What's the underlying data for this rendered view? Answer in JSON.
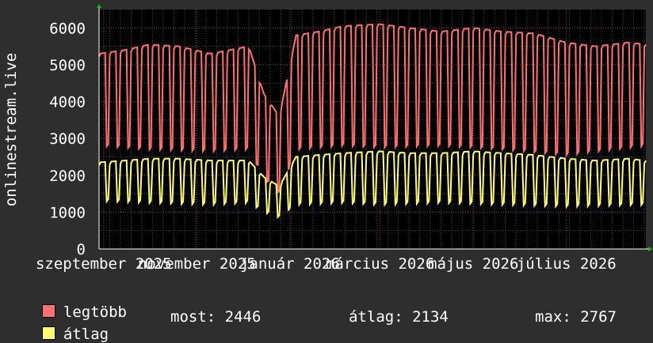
{
  "chart_data": {
    "type": "line",
    "ylabel": "onlinestream.live",
    "ylim": [
      0,
      6500
    ],
    "yticks": [
      0,
      1000,
      2000,
      3000,
      4000,
      5000,
      6000
    ],
    "grid": true,
    "xlim": [
      "2025-08-29",
      "2026-08-22"
    ],
    "xticks": [
      {
        "date": "2025-09-01",
        "label": "szeptember 2025"
      },
      {
        "date": "2025-11-01",
        "label": "november 2025"
      },
      {
        "date": "2026-01-01",
        "label": "január 2026"
      },
      {
        "date": "2026-03-01",
        "label": "március 2026"
      },
      {
        "date": "2026-05-01",
        "label": "május 2026"
      },
      {
        "date": "2026-07-01",
        "label": "július 2026"
      }
    ],
    "series": [
      {
        "name": "legtöbb",
        "color": "#ff7070",
        "values": [
          {
            "x": "2025-08-29",
            "y": 5300
          },
          {
            "x": "2025-09-15",
            "y": 5400
          },
          {
            "x": "2025-10-01",
            "y": 5550
          },
          {
            "x": "2025-10-20",
            "y": 5500
          },
          {
            "x": "2025-11-10",
            "y": 5300
          },
          {
            "x": "2025-12-05",
            "y": 5500
          },
          {
            "x": "2025-12-15",
            "y": 4200
          },
          {
            "x": "2025-12-25",
            "y": 3600
          },
          {
            "x": "2026-01-05",
            "y": 5800
          },
          {
            "x": "2026-01-20",
            "y": 5900
          },
          {
            "x": "2026-02-05",
            "y": 6050
          },
          {
            "x": "2026-03-01",
            "y": 6100
          },
          {
            "x": "2026-03-20",
            "y": 6000
          },
          {
            "x": "2026-04-10",
            "y": 5900
          },
          {
            "x": "2026-05-01",
            "y": 6000
          },
          {
            "x": "2026-05-20",
            "y": 5900
          },
          {
            "x": "2026-06-10",
            "y": 5850
          },
          {
            "x": "2026-07-01",
            "y": 5600
          },
          {
            "x": "2026-07-20",
            "y": 5500
          },
          {
            "x": "2026-08-10",
            "y": 5600
          },
          {
            "x": "2026-08-22",
            "y": 5550
          }
        ],
        "low": [
          {
            "x": "2025-08-29",
            "y": 2800
          },
          {
            "x": "2025-10-01",
            "y": 2700
          },
          {
            "x": "2025-11-10",
            "y": 2650
          },
          {
            "x": "2025-12-05",
            "y": 2700
          },
          {
            "x": "2025-12-15",
            "y": 1900
          },
          {
            "x": "2025-12-25",
            "y": 1500
          },
          {
            "x": "2026-01-05",
            "y": 2700
          },
          {
            "x": "2026-02-05",
            "y": 2800
          },
          {
            "x": "2026-03-01",
            "y": 2750
          },
          {
            "x": "2026-04-10",
            "y": 2800
          },
          {
            "x": "2026-05-20",
            "y": 2700
          },
          {
            "x": "2026-07-01",
            "y": 2550
          },
          {
            "x": "2026-08-22",
            "y": 2800
          }
        ]
      },
      {
        "name": "átlag",
        "color": "#ffff70",
        "values": [
          {
            "x": "2025-08-29",
            "y": 2350
          },
          {
            "x": "2025-09-15",
            "y": 2400
          },
          {
            "x": "2025-10-01",
            "y": 2450
          },
          {
            "x": "2025-10-20",
            "y": 2450
          },
          {
            "x": "2025-11-10",
            "y": 2400
          },
          {
            "x": "2025-12-05",
            "y": 2400
          },
          {
            "x": "2025-12-15",
            "y": 1950
          },
          {
            "x": "2025-12-25",
            "y": 1700
          },
          {
            "x": "2026-01-05",
            "y": 2500
          },
          {
            "x": "2026-01-20",
            "y": 2550
          },
          {
            "x": "2026-02-05",
            "y": 2600
          },
          {
            "x": "2026-03-01",
            "y": 2650
          },
          {
            "x": "2026-03-20",
            "y": 2600
          },
          {
            "x": "2026-04-10",
            "y": 2600
          },
          {
            "x": "2026-05-01",
            "y": 2650
          },
          {
            "x": "2026-05-20",
            "y": 2600
          },
          {
            "x": "2026-06-10",
            "y": 2550
          },
          {
            "x": "2026-07-01",
            "y": 2450
          },
          {
            "x": "2026-07-20",
            "y": 2400
          },
          {
            "x": "2026-08-10",
            "y": 2450
          },
          {
            "x": "2026-08-22",
            "y": 2400
          }
        ],
        "low": [
          {
            "x": "2025-08-29",
            "y": 1300
          },
          {
            "x": "2025-10-01",
            "y": 1250
          },
          {
            "x": "2025-11-10",
            "y": 1200
          },
          {
            "x": "2025-12-05",
            "y": 1250
          },
          {
            "x": "2025-12-15",
            "y": 1000
          },
          {
            "x": "2025-12-25",
            "y": 850
          },
          {
            "x": "2026-01-05",
            "y": 1200
          },
          {
            "x": "2026-02-05",
            "y": 1250
          },
          {
            "x": "2026-03-01",
            "y": 1200
          },
          {
            "x": "2026-04-10",
            "y": 1250
          },
          {
            "x": "2026-05-20",
            "y": 1200
          },
          {
            "x": "2026-07-01",
            "y": 1150
          },
          {
            "x": "2026-08-22",
            "y": 1200
          }
        ]
      }
    ]
  },
  "legend": {
    "max_label": "legtöbb",
    "avg_label": "átlag",
    "max_color": "#ff7070",
    "avg_color": "#ffff70"
  },
  "stats": {
    "most": "most: 2446",
    "atlag": "átlag: 2134",
    "max": "max: 2767"
  }
}
